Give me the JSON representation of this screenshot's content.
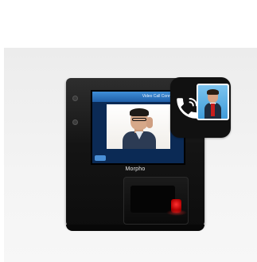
{
  "device": {
    "screen_status": "Video Call Connected",
    "brand": "Morpho"
  },
  "icons": {
    "app_icon": "video-call-app-icon",
    "phone": "phone-handset-icon",
    "contact": "contact-portrait-icon",
    "sensor": "fingerprint-sensor-icon"
  },
  "colors": {
    "app_icon_bg": "#111111",
    "contact_card_bg": "#3f9bd9",
    "sensor_red": "#e00000",
    "screen_header": "#2f78c4"
  }
}
